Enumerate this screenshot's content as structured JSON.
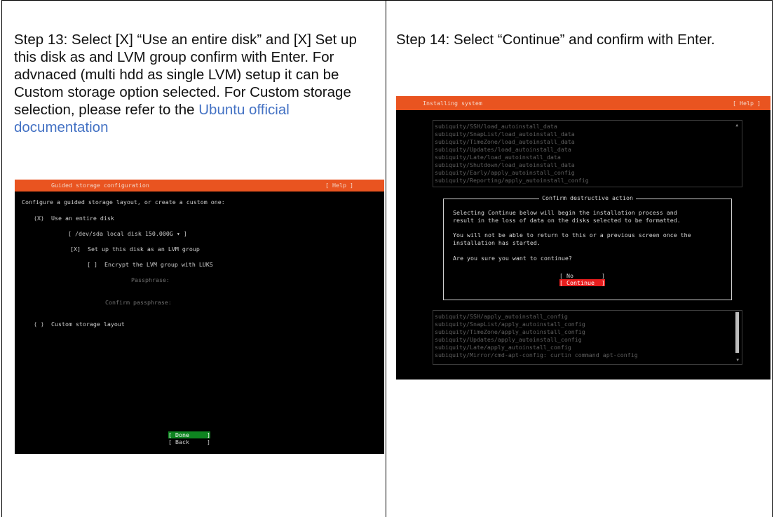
{
  "left_cell": {
    "instruction": "Step 13: Select [X] “Use an entire disk” and [X] Set up this disk as and LVM group confirm with Enter.  For advnaced (multi hdd as single LVM) setup it can be Custom storage option selected. For Custom storage selection, please refer to the ",
    "link_text": "Ubuntu official documentation",
    "screen": {
      "title": "Guided storage configuration",
      "help": "[ Help ]",
      "prompt": "Configure a guided storage layout, or create a custom one:",
      "use_entire_disk": "(X)  Use an entire disk",
      "disk_select": "[ /dev/sda local disk 150.000G ▾ ]",
      "lvm_option": "[X]  Set up this disk as an LVM group",
      "encrypt_option": "[ ]  Encrypt the LVM group with LUKS",
      "passphrase_label": "Passphrase:",
      "confirm_passphrase_label": "Confirm passphrase:",
      "custom_layout": "( )  Custom storage layout",
      "done_button": "[ Done     ]",
      "back_button": "[ Back     ]"
    }
  },
  "right_cell": {
    "instruction": "Step 14: Select “Continue” and confirm with Enter.",
    "screen": {
      "title": "Installing system",
      "help": "[ Help ]",
      "log_top": [
        "subiquity/SSH/load_autoinstall_data",
        "subiquity/SnapList/load_autoinstall_data",
        "subiquity/TimeZone/load_autoinstall_data",
        "subiquity/Updates/load_autoinstall_data",
        "subiquity/Late/load_autoinstall_data",
        "subiquity/Shutdown/load_autoinstall_data",
        "subiquity/Early/apply_autoinstall_config",
        "subiquity/Reporting/apply_autoinstall_config"
      ],
      "dialog_title": "Confirm destructive action",
      "dialog_line1": "Selecting Continue below will begin the installation process and",
      "dialog_line2": "result in the loss of data on the disks selected to be formatted.",
      "dialog_line3": "You will not be able to return to this or a previous screen once the",
      "dialog_line4": "installation has started.",
      "dialog_question": "Are you sure you want to continue?",
      "no_button": "[ No        ]",
      "continue_button": "[ Continue  ]",
      "log_bottom": [
        "subiquity/SSH/apply_autoinstall_config",
        "subiquity/SnapList/apply_autoinstall_config",
        "subiquity/TimeZone/apply_autoinstall_config",
        "subiquity/Updates/apply_autoinstall_config",
        "subiquity/Late/apply_autoinstall_config",
        "subiquity/Mirror/cmd-apt-config: curtin command apt-config"
      ]
    }
  },
  "colors": {
    "ubuntu_orange": "#e95420",
    "done_green": "#0e8420",
    "continue_red": "#e81d1d",
    "link_blue": "#4472c4"
  }
}
